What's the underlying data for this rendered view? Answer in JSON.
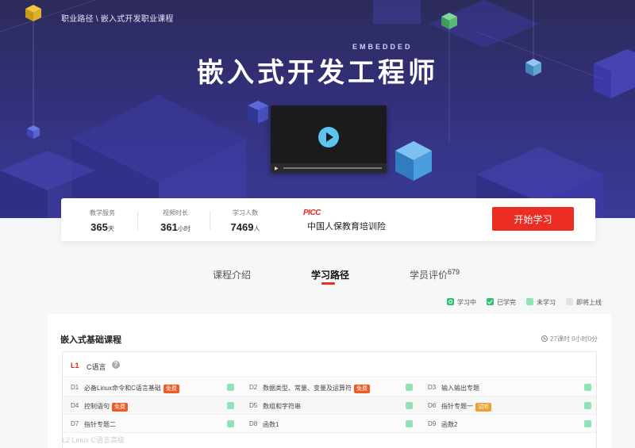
{
  "breadcrumb": {
    "root": "职业路径",
    "separator": "\\",
    "current": "嵌入式开发职业课程"
  },
  "hero": {
    "title": "嵌入式开发工程师",
    "subtitle": "EMBEDDED"
  },
  "video": {
    "play_icon": "play-icon"
  },
  "stats": [
    {
      "label": "教学服务",
      "value": "365",
      "unit": "天"
    },
    {
      "label": "视频时长",
      "value": "361",
      "unit": "小时"
    },
    {
      "label": "学习人数",
      "value": "7469",
      "unit": "人"
    }
  ],
  "partner": {
    "logo": "PICC",
    "name": "中国人保教育培训险"
  },
  "start_button": "开始学习",
  "tabs": [
    {
      "label": "课程介绍",
      "count": ""
    },
    {
      "label": "学习路径",
      "count": ""
    },
    {
      "label": "学员评价",
      "count": "679"
    }
  ],
  "legend": [
    {
      "label": "学习中",
      "icon": "learning-icon"
    },
    {
      "label": "已学完",
      "icon": "learned-icon"
    },
    {
      "label": "未学习",
      "icon": "unlearned-icon"
    },
    {
      "label": "即将上线",
      "icon": "coming-soon-icon"
    }
  ],
  "course": {
    "title": "嵌入式基础课程",
    "meta": "27课时  0小时0分",
    "modules": [
      {
        "level": "L1",
        "name": "C语言",
        "lessons": [
          {
            "num": "D1",
            "title": "必备Linux命令和C语言基础",
            "badge": "免费"
          },
          {
            "num": "D2",
            "title": "数据类型、常量、变量及运算符",
            "badge": "免费"
          },
          {
            "num": "D3",
            "title": "输入输出专题",
            "badge": ""
          },
          {
            "num": "D4",
            "title": "控制语句",
            "badge": "免费"
          },
          {
            "num": "D5",
            "title": "数组和字符串",
            "badge": ""
          },
          {
            "num": "D6",
            "title": "指针专题一",
            "badge": "试听"
          },
          {
            "num": "D7",
            "title": "指针专题二",
            "badge": ""
          },
          {
            "num": "D8",
            "title": "函数1",
            "badge": ""
          },
          {
            "num": "D9",
            "title": "函数2",
            "badge": ""
          }
        ]
      }
    ],
    "next_module_level": "L2",
    "next_module_name": "Linux C语言高级"
  },
  "colors": {
    "accent": "#ec2d24",
    "status_green": "#2fc070",
    "status_light": "#8fe3b6",
    "hero_bg": "#33307a"
  }
}
